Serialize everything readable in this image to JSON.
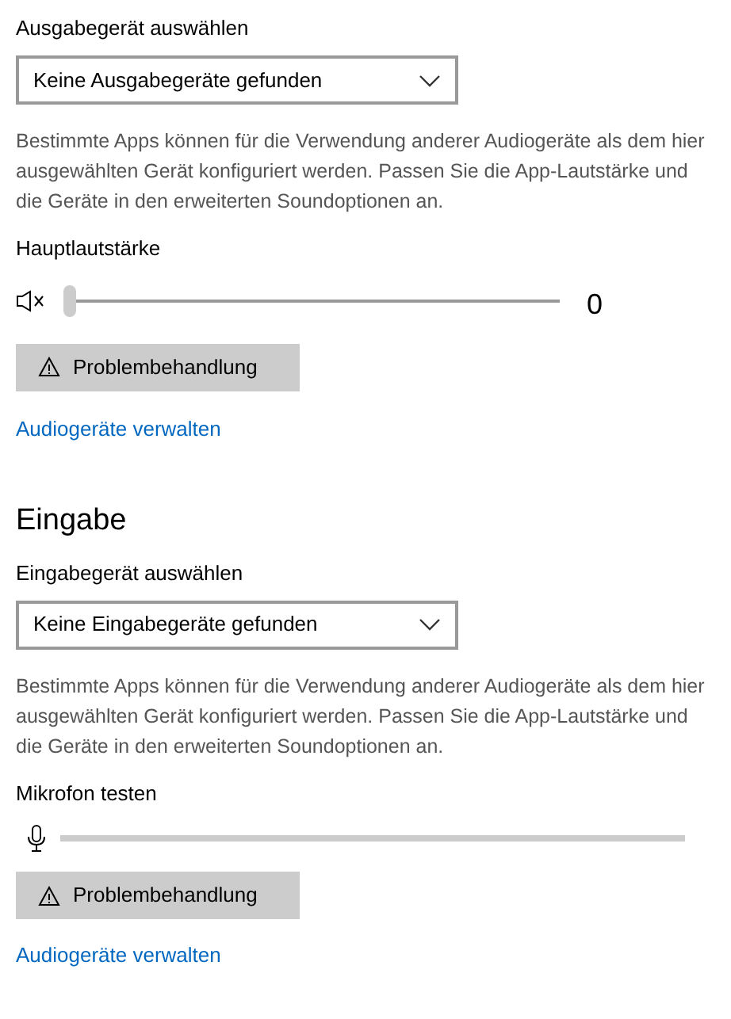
{
  "output": {
    "device_label": "Ausgabegerät auswählen",
    "device_dropdown": {
      "value": "Keine Ausgabegeräte gefunden"
    },
    "info": "Bestimmte Apps können für die Verwendung anderer Audiogeräte als dem hier ausgewählten Gerät konfiguriert werden. Passen Sie die App-Lautstärke und die Geräte in den erweiterten Soundoptionen an.",
    "volume_label": "Hauptlautstärke",
    "volume": {
      "level": 0,
      "reading": "0",
      "muted": true
    },
    "troubleshoot_button": "Problembehandlung",
    "manage_link": "Audiogeräte verwalten"
  },
  "input": {
    "heading": "Eingabe",
    "device_label": "Eingabegerät auswählen",
    "device_dropdown": {
      "value": "Keine Eingabegeräte gefunden"
    },
    "info": "Bestimmte Apps können für die Verwendung anderer Audiogeräte als dem hier ausgewählten Gerät konfiguriert werden. Passen Sie die App-Lautstärke und die Geräte in den erweiterten Soundoptionen an.",
    "test_label": "Mikrofon testen",
    "mic": {
      "level": 0
    },
    "troubleshoot_button": "Problembehandlung",
    "manage_link": "Audiogeräte verwalten"
  }
}
